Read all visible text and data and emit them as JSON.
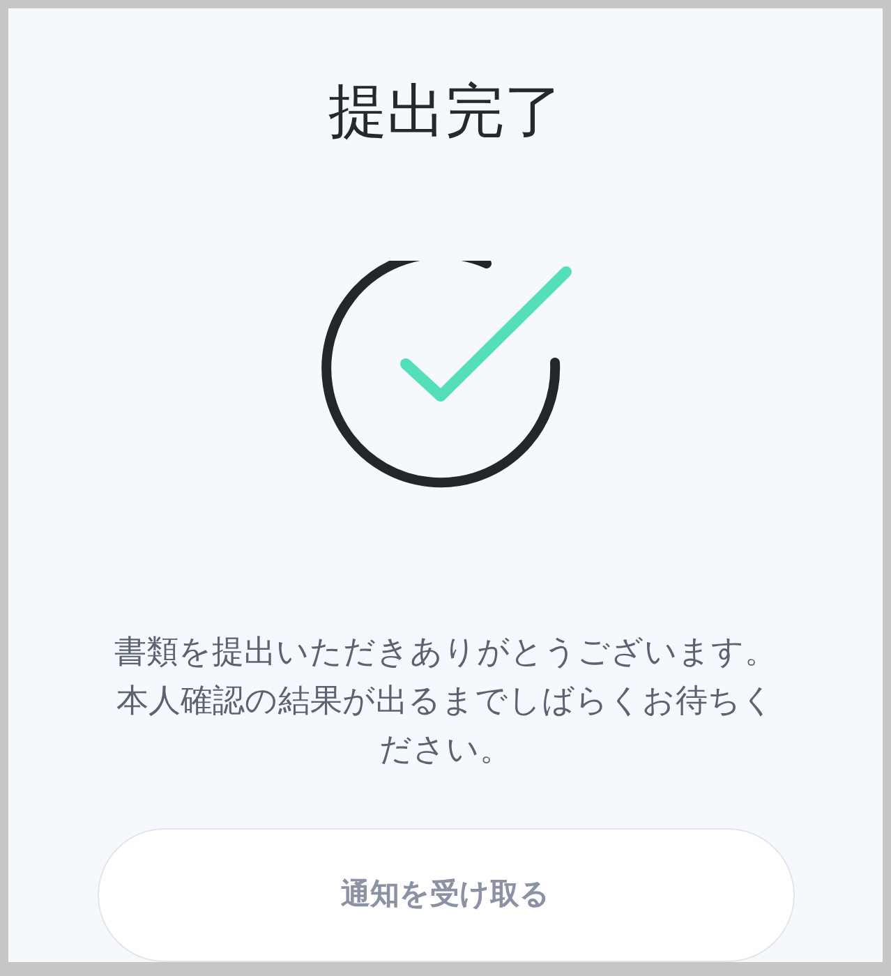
{
  "title": "提出完了",
  "message": "書類を提出いただきありがとうございます。本人確認の結果が出るまでしばらくお待ちください。",
  "button": {
    "label": "通知を受け取る"
  }
}
